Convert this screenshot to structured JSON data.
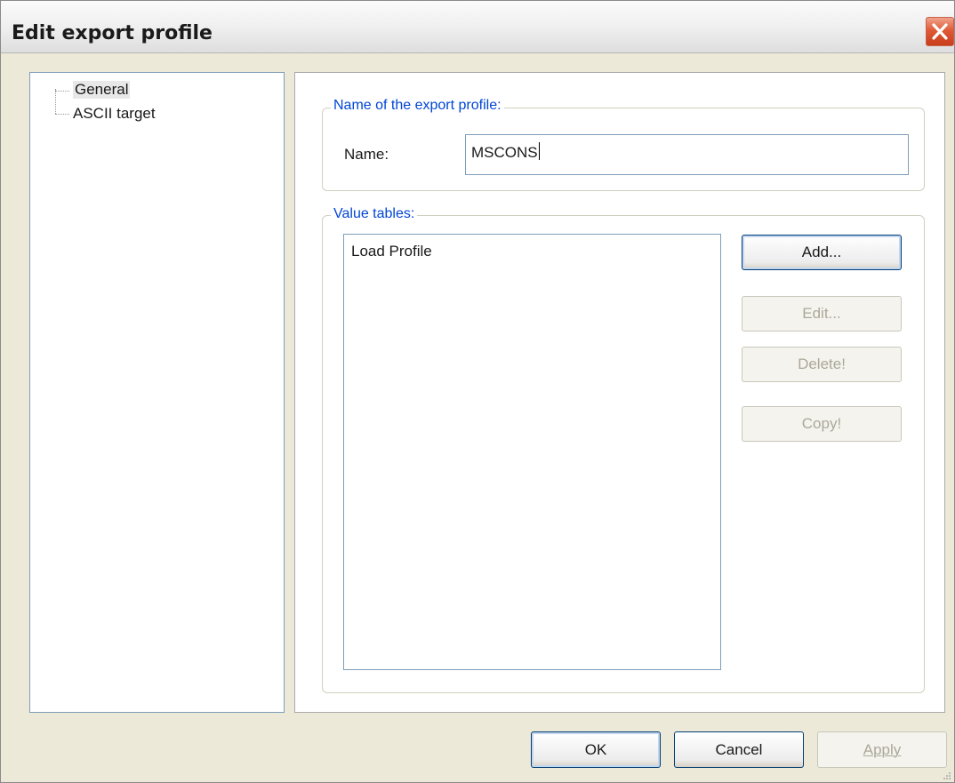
{
  "window": {
    "title": "Edit export profile",
    "close_icon": "close-icon"
  },
  "tree": {
    "items": [
      {
        "label": "General",
        "selected": true
      },
      {
        "label": "ASCII target",
        "selected": false
      }
    ]
  },
  "profile_name_group": {
    "legend": "Name of the export profile:",
    "name_label": "Name:",
    "name_value": "MSCONS"
  },
  "value_tables_group": {
    "legend": "Value tables:",
    "items": [
      "Load Profile"
    ],
    "buttons": {
      "add": "Add...",
      "edit": "Edit...",
      "delete": "Delete!",
      "copy": "Copy!"
    }
  },
  "footer": {
    "ok": "OK",
    "cancel": "Cancel",
    "apply": "Apply"
  },
  "colors": {
    "legend_text": "#0046d5",
    "close_button": "#e05a36",
    "window_bg": "#ece9d8"
  }
}
